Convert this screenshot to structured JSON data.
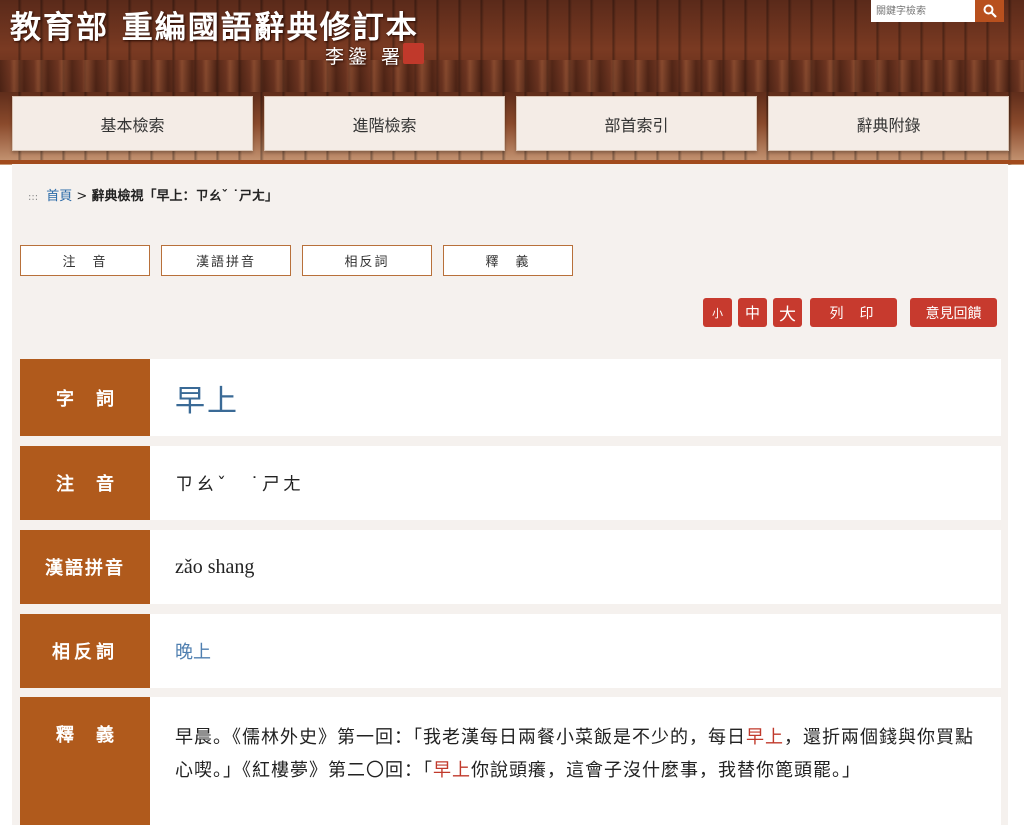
{
  "header": {
    "title": "教育部 重編國語辭典修訂本",
    "subtitle": "李鍌 署",
    "seal_text": "李鍌之印",
    "search_placeholder": "關鍵字檢索"
  },
  "nav": {
    "items": [
      {
        "label": "基本檢索"
      },
      {
        "label": "進階檢索"
      },
      {
        "label": "部首索引"
      },
      {
        "label": "辭典附錄"
      }
    ]
  },
  "breadcrumb": {
    "prefix": ":::",
    "home": "首頁",
    "separator": ">",
    "current": "辭典檢視「早上：ㄗㄠˇ ˙ㄕㄤ」"
  },
  "tabs": [
    {
      "label": "注　音"
    },
    {
      "label": "漢語拼音"
    },
    {
      "label": "相反詞"
    },
    {
      "label": "釋　義"
    }
  ],
  "tools": {
    "small": "小",
    "medium": "中",
    "large": "大",
    "print": "列印",
    "feedback": "意見回饋"
  },
  "entry": {
    "word_label": "字詞",
    "word": "早上",
    "zhuyin_label": "注音",
    "zhuyin": "ㄗㄠˇ　˙ㄕㄤ",
    "pinyin_label": "漢語拼音",
    "pinyin": "zǎo  shang",
    "antonym_label": "相反詞",
    "antonym": "晚上",
    "definition_label": "釋義",
    "definition_part1": "早晨。《儒林外史》第一回：「我老漢每日兩餐小菜飯是不少的，每日",
    "definition_hl1": "早上",
    "definition_part2": "，還折兩個錢與你買點心喫。」《紅樓夢》第二〇回：「",
    "definition_hl2": "早上",
    "definition_part3": "你說頭癢，這會子沒什麼事，我替你篦頭罷。」"
  },
  "colors": {
    "accent": "#b05a1c",
    "button": "#c73a2e",
    "link": "#2a6aa8"
  }
}
